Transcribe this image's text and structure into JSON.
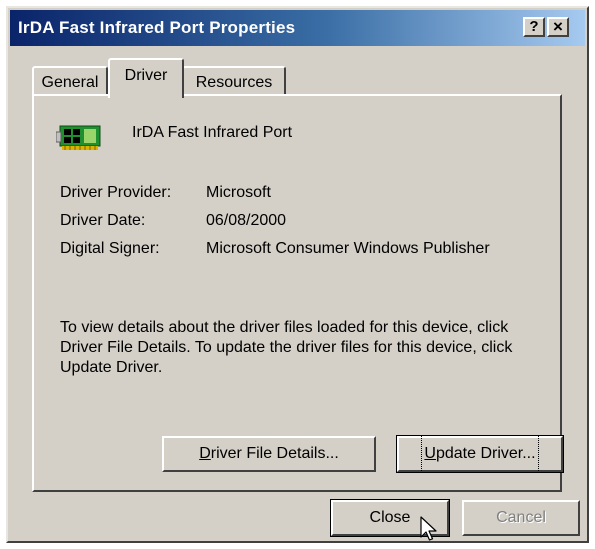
{
  "window": {
    "title": "IrDA Fast Infrared Port Properties",
    "help_button": "?",
    "close_button": "×"
  },
  "tabs": [
    {
      "label": "General",
      "selected": false
    },
    {
      "label": "Driver",
      "selected": true
    },
    {
      "label": "Resources",
      "selected": false
    }
  ],
  "device": {
    "icon": "network-card-icon",
    "name": "IrDA Fast Infrared Port"
  },
  "driver_info": {
    "provider_label": "Driver Provider:",
    "provider_value": "Microsoft",
    "date_label": "Driver Date:",
    "date_value": "06/08/2000",
    "signer_label": "Digital Signer:",
    "signer_value": "Microsoft Consumer Windows Publisher"
  },
  "description": {
    "line1": "To view details about the driver files loaded for this device, click",
    "line2": "Driver File Details.  To update the driver files for this device, click",
    "line3": "Update Driver."
  },
  "buttons": {
    "driver_file_details_first": "D",
    "driver_file_details_rest": "river File Details...",
    "update_driver_first": "U",
    "update_driver_rest": "pdate Driver...",
    "close": "Close",
    "cancel": "Cancel"
  },
  "colors": {
    "titlebar_start": "#0a246a",
    "titlebar_end": "#a6caf0",
    "face": "#d4d0c8"
  }
}
